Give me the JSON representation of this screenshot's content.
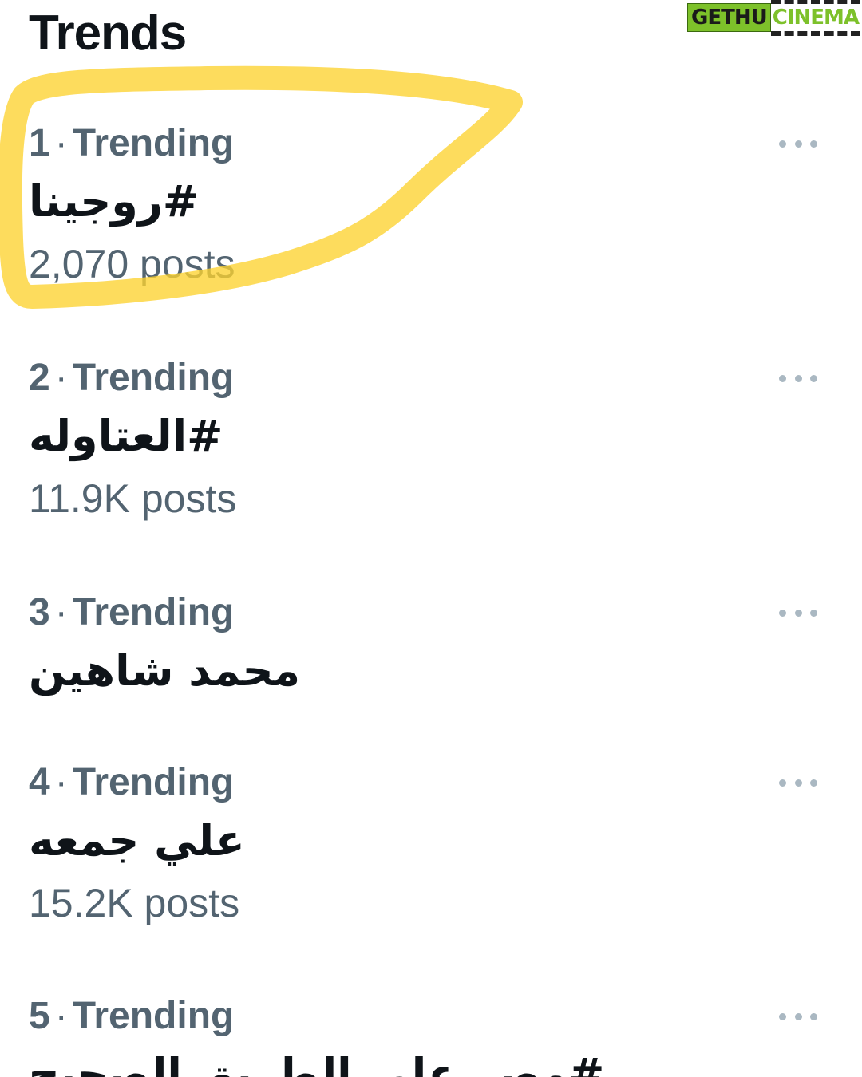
{
  "header": {
    "title": "Trends"
  },
  "watermark": {
    "part_a": "GETHU",
    "part_b": "CINEMA"
  },
  "colors": {
    "primary_text": "#0f1419",
    "secondary_text": "#536471",
    "highlight": "#fcd22f"
  },
  "trends": [
    {
      "rank": "1",
      "label": "Trending",
      "name": "#روجينا",
      "posts": "2,070 posts",
      "more_icon": "more-horizontal-icon"
    },
    {
      "rank": "2",
      "label": "Trending",
      "name": "#العتاوله",
      "posts": "11.9K posts",
      "more_icon": "more-horizontal-icon"
    },
    {
      "rank": "3",
      "label": "Trending",
      "name": "محمد شاهين",
      "posts": "",
      "more_icon": "more-horizontal-icon"
    },
    {
      "rank": "4",
      "label": "Trending",
      "name": "علي جمعه",
      "posts": "15.2K posts",
      "more_icon": "more-horizontal-icon"
    },
    {
      "rank": "5",
      "label": "Trending",
      "name": "#مصر على الطريق الصحيح",
      "posts": "",
      "more_icon": "more-horizontal-icon"
    }
  ],
  "separator": "·"
}
